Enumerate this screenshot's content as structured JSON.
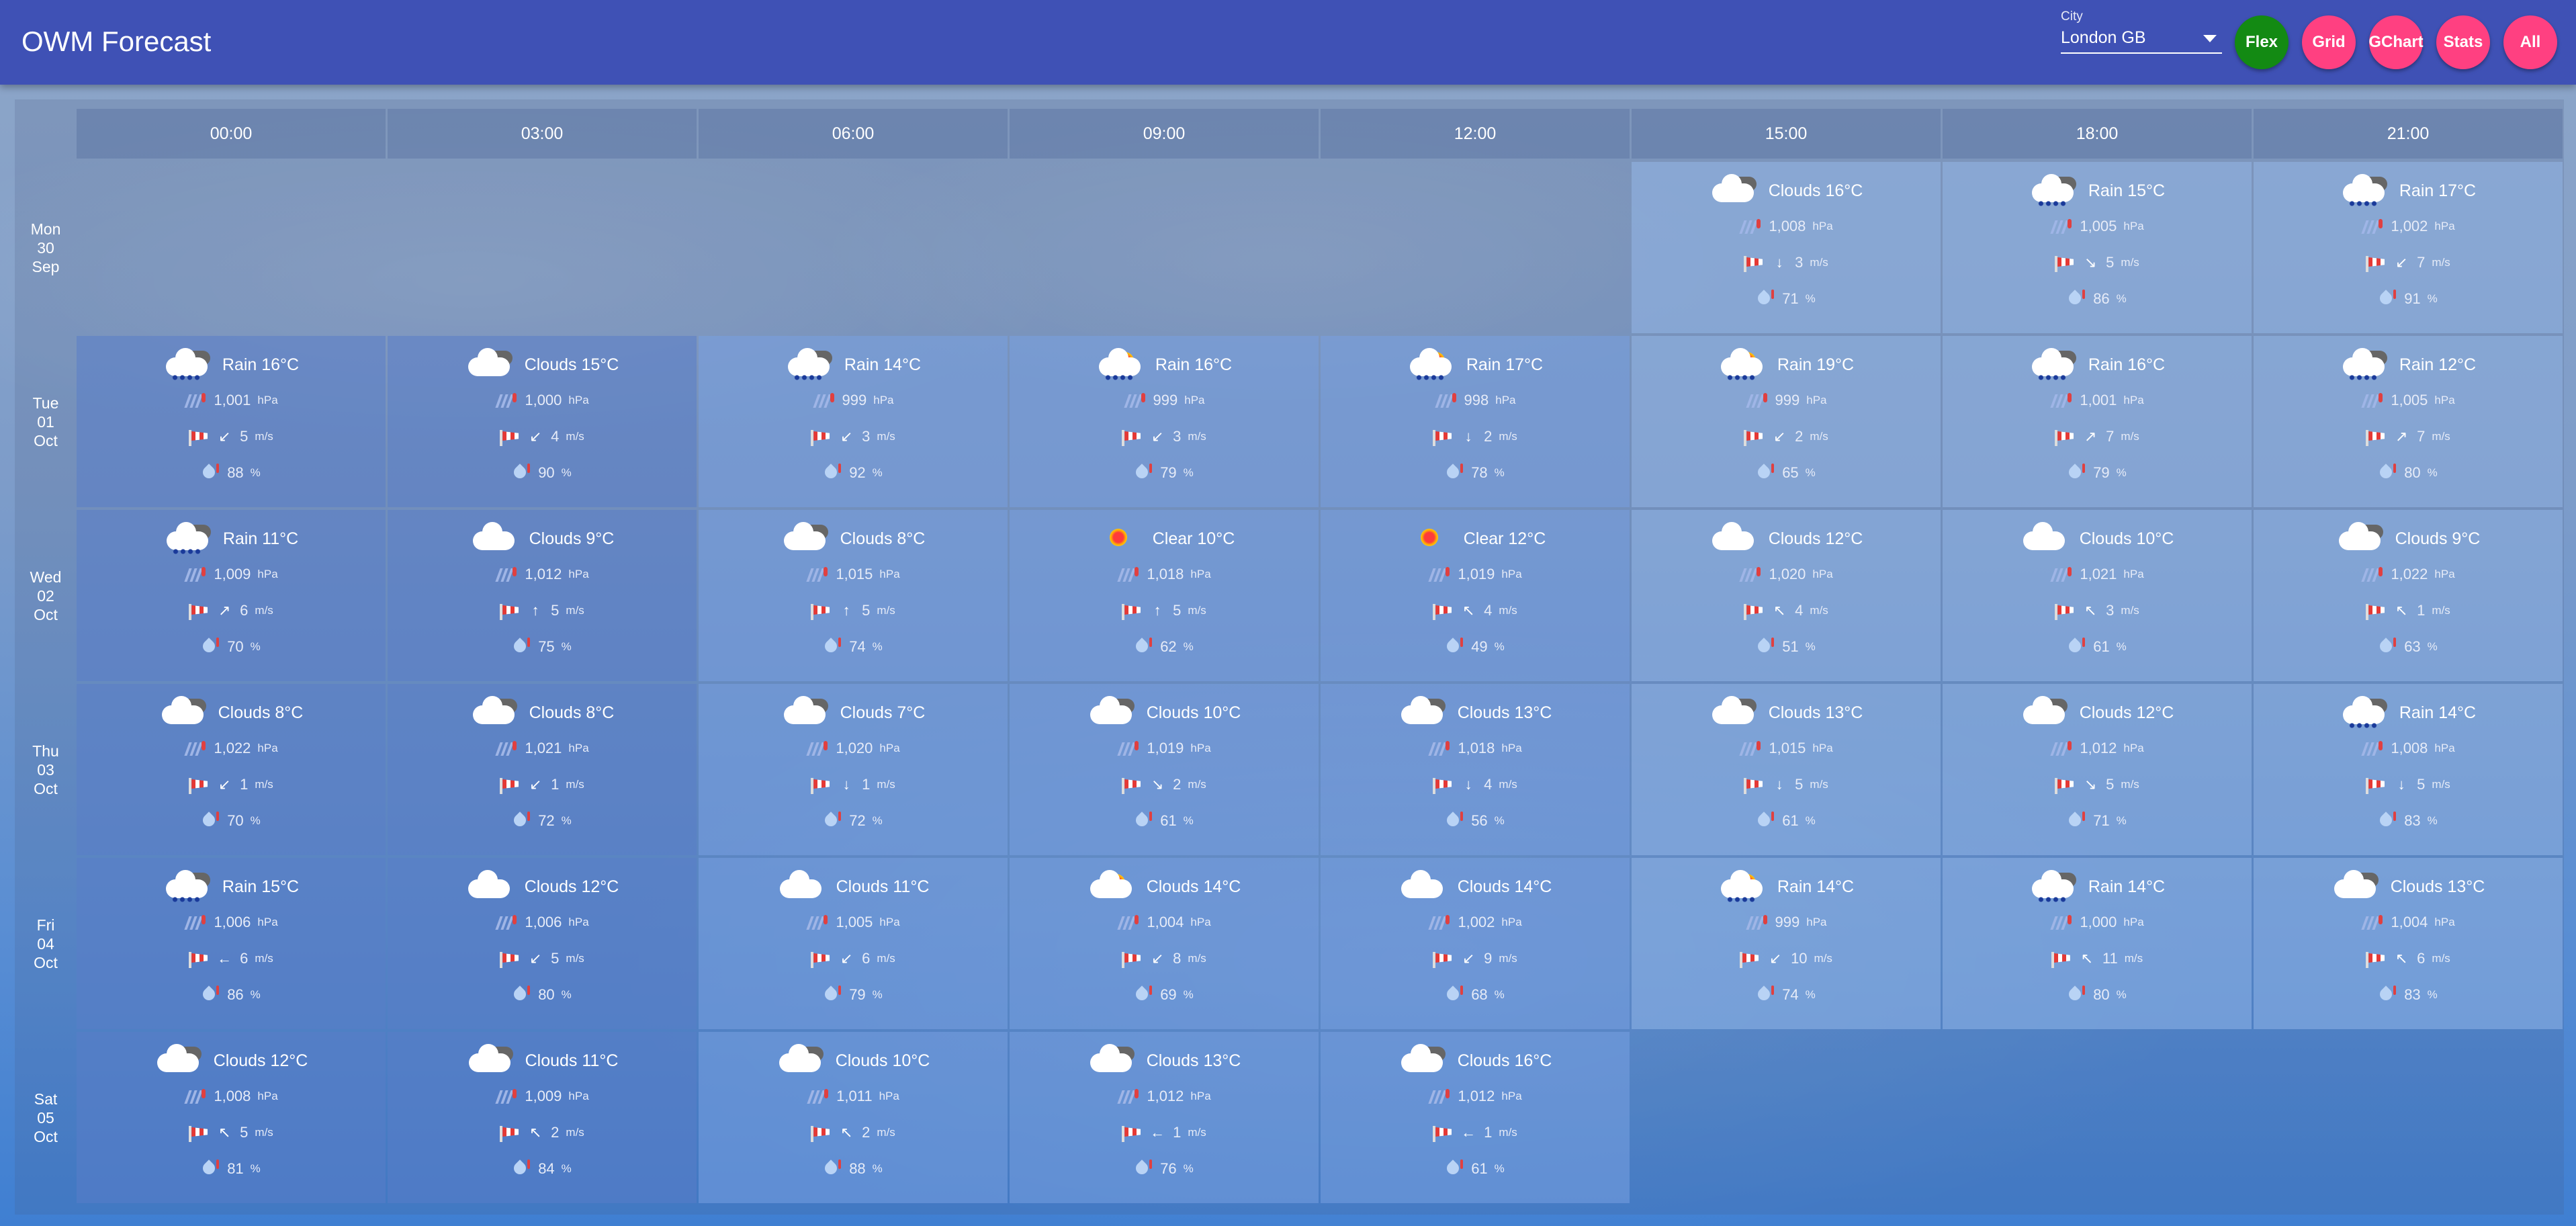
{
  "app": {
    "title": "OWM Forecast",
    "city_caption": "City",
    "city_value": "London GB",
    "nav": [
      "Flex",
      "Grid",
      "GChart",
      "Stats",
      "All"
    ],
    "active_nav": "Flex"
  },
  "hours": [
    "00:00",
    "03:00",
    "06:00",
    "09:00",
    "12:00",
    "15:00",
    "18:00",
    "21:00"
  ],
  "days": [
    {
      "dow": "Mon",
      "date": "30",
      "month": "Sep",
      "first_slot": 5,
      "cells": [
        {
          "cond": "Clouds 16°C",
          "icon": "cloud-dark-icon",
          "p": "1,008",
          "pu": "hPa",
          "w": "3",
          "wu": "m/s",
          "dir": "↓",
          "h": "71",
          "hu": "%"
        },
        {
          "cond": "Rain 15°C",
          "icon": "rain-icon",
          "p": "1,005",
          "pu": "hPa",
          "w": "5",
          "wu": "m/s",
          "dir": "↘",
          "h": "86",
          "hu": "%"
        },
        {
          "cond": "Rain 17°C",
          "icon": "rain-icon",
          "p": "1,002",
          "pu": "hPa",
          "w": "7",
          "wu": "m/s",
          "dir": "↙",
          "h": "91",
          "hu": "%"
        }
      ]
    },
    {
      "dow": "Tue",
      "date": "01",
      "month": "Oct",
      "first_slot": 0,
      "cells": [
        {
          "cond": "Rain 16°C",
          "icon": "rain-icon",
          "p": "1,001",
          "pu": "hPa",
          "w": "5",
          "wu": "m/s",
          "dir": "↙",
          "h": "88",
          "hu": "%"
        },
        {
          "cond": "Clouds 15°C",
          "icon": "cloud-dark-icon",
          "p": "1,000",
          "pu": "hPa",
          "w": "4",
          "wu": "m/s",
          "dir": "↙",
          "h": "90",
          "hu": "%"
        },
        {
          "cond": "Rain 14°C",
          "icon": "rain-icon",
          "p": "999",
          "pu": "hPa",
          "w": "3",
          "wu": "m/s",
          "dir": "↙",
          "h": "92",
          "hu": "%"
        },
        {
          "cond": "Rain 16°C",
          "icon": "rain-sun-icon",
          "p": "999",
          "pu": "hPa",
          "w": "3",
          "wu": "m/s",
          "dir": "↙",
          "h": "79",
          "hu": "%"
        },
        {
          "cond": "Rain 17°C",
          "icon": "rain-sun-icon",
          "p": "998",
          "pu": "hPa",
          "w": "2",
          "wu": "m/s",
          "dir": "↓",
          "h": "78",
          "hu": "%"
        },
        {
          "cond": "Rain 19°C",
          "icon": "rain-sun-icon",
          "p": "999",
          "pu": "hPa",
          "w": "2",
          "wu": "m/s",
          "dir": "↙",
          "h": "65",
          "hu": "%"
        },
        {
          "cond": "Rain 16°C",
          "icon": "rain-icon",
          "p": "1,001",
          "pu": "hPa",
          "w": "7",
          "wu": "m/s",
          "dir": "↗",
          "h": "79",
          "hu": "%"
        },
        {
          "cond": "Rain 12°C",
          "icon": "rain-icon",
          "p": "1,005",
          "pu": "hPa",
          "w": "7",
          "wu": "m/s",
          "dir": "↗",
          "h": "80",
          "hu": "%"
        }
      ]
    },
    {
      "dow": "Wed",
      "date": "02",
      "month": "Oct",
      "first_slot": 0,
      "cells": [
        {
          "cond": "Rain 11°C",
          "icon": "rain-icon",
          "p": "1,009",
          "pu": "hPa",
          "w": "6",
          "wu": "m/s",
          "dir": "↗",
          "h": "70",
          "hu": "%"
        },
        {
          "cond": "Clouds 9°C",
          "icon": "cloud-white-icon",
          "p": "1,012",
          "pu": "hPa",
          "w": "5",
          "wu": "m/s",
          "dir": "↑",
          "h": "75",
          "hu": "%"
        },
        {
          "cond": "Clouds 8°C",
          "icon": "cloud-dark-icon",
          "p": "1,015",
          "pu": "hPa",
          "w": "5",
          "wu": "m/s",
          "dir": "↑",
          "h": "74",
          "hu": "%"
        },
        {
          "cond": "Clear 10°C",
          "icon": "sun-icon",
          "p": "1,018",
          "pu": "hPa",
          "w": "5",
          "wu": "m/s",
          "dir": "↑",
          "h": "62",
          "hu": "%"
        },
        {
          "cond": "Clear 12°C",
          "icon": "sun-icon",
          "p": "1,019",
          "pu": "hPa",
          "w": "4",
          "wu": "m/s",
          "dir": "↖",
          "h": "49",
          "hu": "%"
        },
        {
          "cond": "Clouds 12°C",
          "icon": "cloud-white-icon",
          "p": "1,020",
          "pu": "hPa",
          "w": "4",
          "wu": "m/s",
          "dir": "↖",
          "h": "51",
          "hu": "%"
        },
        {
          "cond": "Clouds 10°C",
          "icon": "cloud-white-icon",
          "p": "1,021",
          "pu": "hPa",
          "w": "3",
          "wu": "m/s",
          "dir": "↖",
          "h": "61",
          "hu": "%"
        },
        {
          "cond": "Clouds 9°C",
          "icon": "cloud-dark-icon",
          "p": "1,022",
          "pu": "hPa",
          "w": "1",
          "wu": "m/s",
          "dir": "↖",
          "h": "63",
          "hu": "%"
        }
      ]
    },
    {
      "dow": "Thu",
      "date": "03",
      "month": "Oct",
      "first_slot": 0,
      "cells": [
        {
          "cond": "Clouds 8°C",
          "icon": "cloud-dark-icon",
          "p": "1,022",
          "pu": "hPa",
          "w": "1",
          "wu": "m/s",
          "dir": "↙",
          "h": "70",
          "hu": "%"
        },
        {
          "cond": "Clouds 8°C",
          "icon": "cloud-dark-icon",
          "p": "1,021",
          "pu": "hPa",
          "w": "1",
          "wu": "m/s",
          "dir": "↙",
          "h": "72",
          "hu": "%"
        },
        {
          "cond": "Clouds 7°C",
          "icon": "cloud-dark-icon",
          "p": "1,020",
          "pu": "hPa",
          "w": "1",
          "wu": "m/s",
          "dir": "↓",
          "h": "72",
          "hu": "%"
        },
        {
          "cond": "Clouds 10°C",
          "icon": "cloud-dark-icon",
          "p": "1,019",
          "pu": "hPa",
          "w": "2",
          "wu": "m/s",
          "dir": "↘",
          "h": "61",
          "hu": "%"
        },
        {
          "cond": "Clouds 13°C",
          "icon": "cloud-dark-icon",
          "p": "1,018",
          "pu": "hPa",
          "w": "4",
          "wu": "m/s",
          "dir": "↓",
          "h": "56",
          "hu": "%"
        },
        {
          "cond": "Clouds 13°C",
          "icon": "cloud-dark-icon",
          "p": "1,015",
          "pu": "hPa",
          "w": "5",
          "wu": "m/s",
          "dir": "↓",
          "h": "61",
          "hu": "%"
        },
        {
          "cond": "Clouds 12°C",
          "icon": "cloud-dark-icon",
          "p": "1,012",
          "pu": "hPa",
          "w": "5",
          "wu": "m/s",
          "dir": "↘",
          "h": "71",
          "hu": "%"
        },
        {
          "cond": "Rain 14°C",
          "icon": "rain-icon",
          "p": "1,008",
          "pu": "hPa",
          "w": "5",
          "wu": "m/s",
          "dir": "↓",
          "h": "83",
          "hu": "%"
        }
      ]
    },
    {
      "dow": "Fri",
      "date": "04",
      "month": "Oct",
      "first_slot": 0,
      "cells": [
        {
          "cond": "Rain 15°C",
          "icon": "rain-icon",
          "p": "1,006",
          "pu": "hPa",
          "w": "6",
          "wu": "m/s",
          "dir": "←",
          "h": "86",
          "hu": "%"
        },
        {
          "cond": "Clouds 12°C",
          "icon": "cloud-white-icon",
          "p": "1,006",
          "pu": "hPa",
          "w": "5",
          "wu": "m/s",
          "dir": "↙",
          "h": "80",
          "hu": "%"
        },
        {
          "cond": "Clouds 11°C",
          "icon": "cloud-white-icon",
          "p": "1,005",
          "pu": "hPa",
          "w": "6",
          "wu": "m/s",
          "dir": "↙",
          "h": "79",
          "hu": "%"
        },
        {
          "cond": "Clouds 14°C",
          "icon": "cloud-sun-icon",
          "p": "1,004",
          "pu": "hPa",
          "w": "8",
          "wu": "m/s",
          "dir": "↙",
          "h": "69",
          "hu": "%"
        },
        {
          "cond": "Clouds 14°C",
          "icon": "cloud-white-icon",
          "p": "1,002",
          "pu": "hPa",
          "w": "9",
          "wu": "m/s",
          "dir": "↙",
          "h": "68",
          "hu": "%"
        },
        {
          "cond": "Rain 14°C",
          "icon": "rain-sun-icon",
          "p": "999",
          "pu": "hPa",
          "w": "10",
          "wu": "m/s",
          "dir": "↙",
          "h": "74",
          "hu": "%"
        },
        {
          "cond": "Rain 14°C",
          "icon": "rain-icon",
          "p": "1,000",
          "pu": "hPa",
          "w": "11",
          "wu": "m/s",
          "dir": "↖",
          "h": "80",
          "hu": "%"
        },
        {
          "cond": "Clouds 13°C",
          "icon": "cloud-dark-icon",
          "p": "1,004",
          "pu": "hPa",
          "w": "6",
          "wu": "m/s",
          "dir": "↖",
          "h": "83",
          "hu": "%"
        }
      ]
    },
    {
      "dow": "Sat",
      "date": "05",
      "month": "Oct",
      "first_slot": 0,
      "cells": [
        {
          "cond": "Clouds 12°C",
          "icon": "cloud-dark-icon",
          "p": "1,008",
          "pu": "hPa",
          "w": "5",
          "wu": "m/s",
          "dir": "↖",
          "h": "81",
          "hu": "%"
        },
        {
          "cond": "Clouds 11°C",
          "icon": "cloud-dark-icon",
          "p": "1,009",
          "pu": "hPa",
          "w": "2",
          "wu": "m/s",
          "dir": "↖",
          "h": "84",
          "hu": "%"
        },
        {
          "cond": "Clouds 10°C",
          "icon": "cloud-dark-icon",
          "p": "1,011",
          "pu": "hPa",
          "w": "2",
          "wu": "m/s",
          "dir": "↖",
          "h": "88",
          "hu": "%"
        },
        {
          "cond": "Clouds 13°C",
          "icon": "cloud-dark-icon",
          "p": "1,012",
          "pu": "hPa",
          "w": "1",
          "wu": "m/s",
          "dir": "←",
          "h": "76",
          "hu": "%"
        },
        {
          "cond": "Clouds 16°C",
          "icon": "cloud-dark-icon",
          "p": "1,012",
          "pu": "hPa",
          "w": "1",
          "wu": "m/s",
          "dir": "←",
          "h": "61",
          "hu": "%"
        }
      ]
    }
  ],
  "colors": {
    "appbar": "#3f51b5",
    "nav_button": "#ff4081",
    "nav_active": "#138a13"
  }
}
